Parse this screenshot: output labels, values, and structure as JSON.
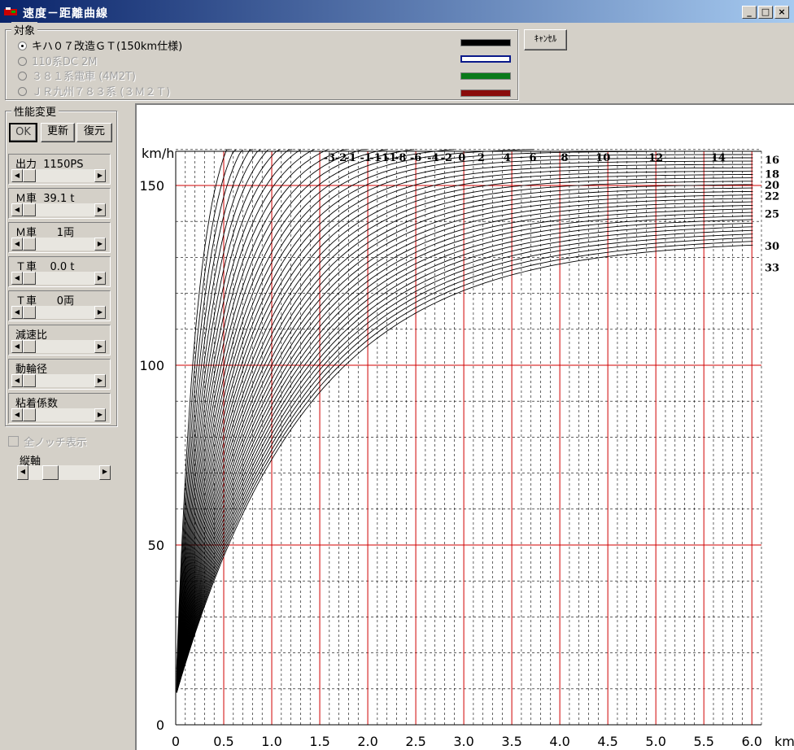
{
  "window": {
    "title": "速度－距離曲線",
    "buttons": [
      "_",
      "□",
      "×"
    ]
  },
  "target": {
    "label": "対象",
    "options": [
      {
        "label": "キハ０７改造ＧＴ(150km仕様)",
        "selected": true,
        "enabled": true,
        "color": "#000000"
      },
      {
        "label": "110系DC 2M",
        "selected": false,
        "enabled": false,
        "color": "#0a1a8a"
      },
      {
        "label": "３８１系電車 (4M2T)",
        "selected": false,
        "enabled": false,
        "color": "#0a7a1a"
      },
      {
        "label": "ＪＲ九州７８３系 (３Ｍ２Ｔ)",
        "selected": false,
        "enabled": false,
        "color": "#8a0a0a"
      }
    ],
    "cancel_label": "ｷｬﾝｾﾙ"
  },
  "performance": {
    "label": "性能変更",
    "ok_label": "OK",
    "update_label": "更新",
    "restore_label": "復元",
    "sliders": [
      {
        "label": "出力  1150PS",
        "level": 0
      },
      {
        "label": "Ｍ車  39.1 t",
        "level": 0
      },
      {
        "label": "Ｍ車      1両",
        "level": 0
      },
      {
        "label": "Ｔ車    0.0 t",
        "level": 0
      },
      {
        "label": "Ｔ車      0両",
        "level": 0
      },
      {
        "label": "減速比",
        "level": 0
      },
      {
        "label": "動輪径",
        "level": 0
      },
      {
        "label": "粘着係数",
        "level": 0
      }
    ]
  },
  "all_notch": {
    "label": "全ノッチ表示",
    "checked": false,
    "enabled": false
  },
  "vertical_axis": {
    "label": "縦軸",
    "level": 0.25
  },
  "chart_data": {
    "type": "line",
    "ylabel": "km/h",
    "xlabel": "km",
    "xlim": [
      0,
      6.0
    ],
    "ylim": [
      0,
      160
    ],
    "x_ticks": [
      "0",
      "0.5",
      "1.0",
      "1.5",
      "2.0",
      "2.5",
      "3.0",
      "3.5",
      "4.0",
      "4.5",
      "5.0",
      "5.5",
      "6.0"
    ],
    "y_ticks": [
      "0",
      "50",
      "100",
      "150"
    ],
    "grid": true,
    "series_color": "#000000",
    "top_labels": [
      "-3",
      "-2",
      "-1",
      "-1",
      "-1",
      "-1",
      "-1",
      "-8",
      "-6",
      "-4",
      "-2",
      "0",
      "2",
      "4",
      "6",
      "8",
      "10",
      "12",
      "14"
    ],
    "right_labels": [
      "16",
      "18",
      "20",
      "22",
      "25",
      "30",
      "33"
    ],
    "right_label_values": [
      160,
      157,
      153,
      150,
      147,
      142,
      133,
      127
    ],
    "top_label_x": [
      1.6,
      1.72,
      1.82,
      1.98,
      2.08,
      2.16,
      2.24,
      2.34,
      2.5,
      2.68,
      2.82,
      2.98,
      3.18,
      3.45,
      3.72,
      4.05,
      4.45,
      5.0,
      5.65
    ]
  }
}
